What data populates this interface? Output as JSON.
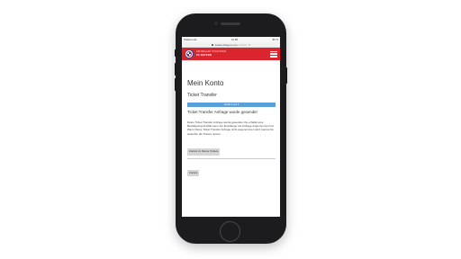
{
  "status_bar": {
    "carrier": "Telekom.de",
    "time": "12:08",
    "battery": "86 %"
  },
  "browser": {
    "url": "tickets.fcbayern.com",
    "reader_label": "Privat"
  },
  "site_header": {
    "line1": "OFFIZIELLER TICKETSHOP",
    "line2": "FC BAYERN"
  },
  "main": {
    "title": "Mein Konto",
    "section_title": "Ticket Transfer",
    "progress_label": "Schritt 3 von 3",
    "status_heading": "Ticket Transfer Anfrage wurde gesendet",
    "body_text": "Deine Ticket Transfer Anfrage wurde gesendet. Du erhältst eine Bestätigungs-E-Mail wenn der Empfänger die Anfrage angenommen hat. Wenn Deine Ticket Transfer Anfrage nicht angenommen wird, kannst Du weiterhin die Tickets nutzen.",
    "back_to_tickets_label": "Zurück zu Meine Tickets",
    "back_label": "Zurück"
  },
  "colors": {
    "brand_red": "#d9262e",
    "progress_blue": "#5aa0d8"
  }
}
